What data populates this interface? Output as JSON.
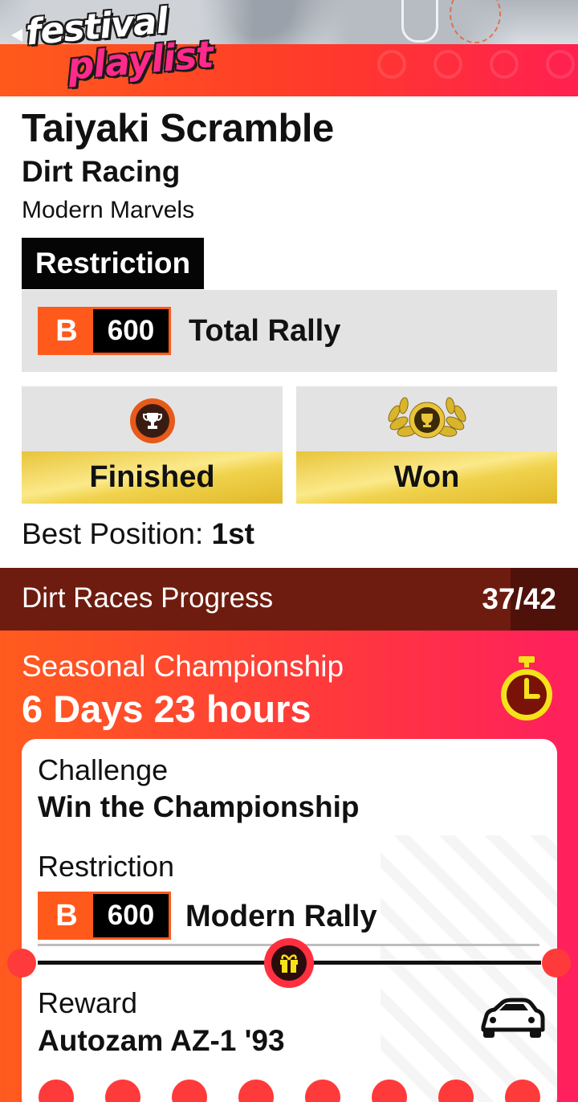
{
  "header": {
    "logo_line1": "festival",
    "logo_line2": "playlist"
  },
  "event": {
    "title": "Taiyaki Scramble",
    "type": "Dirt Racing",
    "category": "Modern Marvels",
    "restriction_heading": "Restriction",
    "restriction": {
      "class_letter": "B",
      "pi": "600",
      "car_class": "Total Rally"
    },
    "medals": [
      {
        "label": "Finished",
        "icon": "trophy-icon"
      },
      {
        "label": "Won",
        "icon": "laurel-trophy-icon"
      }
    ],
    "best_position_label": "Best Position:",
    "best_position_value": "1st"
  },
  "progress": {
    "label": "Dirt Races Progress",
    "count": "37/42"
  },
  "championship": {
    "label": "Seasonal Championship",
    "time_left": "6 Days 23 hours",
    "challenge_label": "Challenge",
    "challenge_value": "Win the Championship",
    "restriction_label": "Restriction",
    "restriction": {
      "class_letter": "B",
      "pi": "600",
      "car_class": "Modern Rally"
    },
    "reward_label": "Reward",
    "reward_value": "Autozam AZ-1 '93"
  },
  "colors": {
    "accent_orange": "#ff5a1c",
    "accent_pink": "#ff1f5e",
    "progress_bar": "#6e1c0f",
    "gold": "#f0d24c",
    "restriction_bg": "#e3e3e3"
  }
}
